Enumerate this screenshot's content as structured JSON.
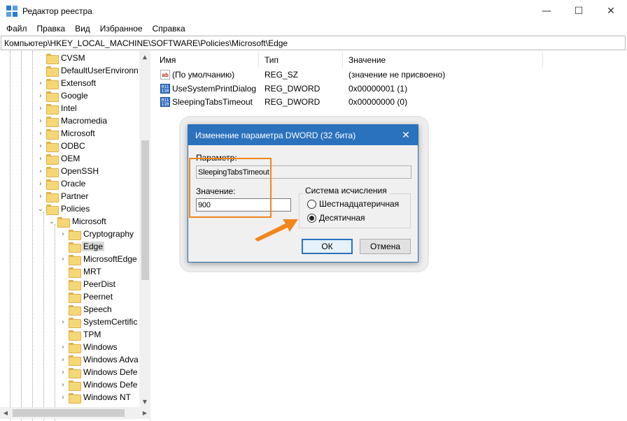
{
  "window": {
    "title": "Редактор реестра",
    "controls": {
      "minimize": "—",
      "maximize": "☐",
      "close": "✕"
    }
  },
  "menu": [
    "Файл",
    "Правка",
    "Вид",
    "Избранное",
    "Справка"
  ],
  "address": "Компьютер\\HKEY_LOCAL_MACHINE\\SOFTWARE\\Policies\\Microsoft\\Edge",
  "tree": {
    "items": [
      {
        "label": "CVSM",
        "expander": ""
      },
      {
        "label": "DefaultUserEnvironn",
        "expander": ""
      },
      {
        "label": "Extensoft",
        "expander": "›"
      },
      {
        "label": "Google",
        "expander": "›"
      },
      {
        "label": "Intel",
        "expander": "›"
      },
      {
        "label": "Macromedia",
        "expander": "›"
      },
      {
        "label": "Microsoft",
        "expander": "›"
      },
      {
        "label": "ODBC",
        "expander": "›"
      },
      {
        "label": "OEM",
        "expander": "›"
      },
      {
        "label": "OpenSSH",
        "expander": "›"
      },
      {
        "label": "Oracle",
        "expander": "›"
      },
      {
        "label": "Partner",
        "expander": "›"
      },
      {
        "label": "Policies",
        "expander": "⌄"
      },
      {
        "label": "Microsoft",
        "expander": "⌄"
      },
      {
        "label": "Cryptography",
        "expander": "›"
      },
      {
        "label": "Edge",
        "expander": ""
      },
      {
        "label": "MicrosoftEdge",
        "expander": "›"
      },
      {
        "label": "MRT",
        "expander": ""
      },
      {
        "label": "PeerDist",
        "expander": ""
      },
      {
        "label": "Peernet",
        "expander": ""
      },
      {
        "label": "Speech",
        "expander": ""
      },
      {
        "label": "SystemCertific",
        "expander": "›"
      },
      {
        "label": "TPM",
        "expander": ""
      },
      {
        "label": "Windows",
        "expander": "›"
      },
      {
        "label": "Windows Adva",
        "expander": "›"
      },
      {
        "label": "Windows Defe",
        "expander": "›"
      },
      {
        "label": "Windows Defe",
        "expander": "›"
      },
      {
        "label": "Windows NT",
        "expander": "›"
      }
    ],
    "selected": "Edge"
  },
  "list": {
    "columns": [
      "Имя",
      "Тип",
      "Значение"
    ],
    "rows": [
      {
        "icon": "string-value-icon",
        "name": "(По умолчанию)",
        "type": "REG_SZ",
        "value": "(значение не присвоено)"
      },
      {
        "icon": "dword-value-icon",
        "name": "UseSystemPrintDialog",
        "type": "REG_DWORD",
        "value": "0x00000001 (1)"
      },
      {
        "icon": "dword-value-icon",
        "name": "SleepingTabsTimeout",
        "type": "REG_DWORD",
        "value": "0x00000000 (0)"
      }
    ]
  },
  "dialog": {
    "title": "Изменение параметра DWORD (32 бита)",
    "param_label": "Параметр:",
    "param_value": "SleepingTabsTimeout",
    "value_label": "Значение:",
    "value_input": "900",
    "base_legend": "Система исчисления",
    "radio_hex": "Шестнадцатеричная",
    "radio_dec": "Десятичная",
    "selected_base": "Десятичная",
    "ok": "ОК",
    "cancel": "Отмена"
  },
  "colors": {
    "accent": "#2b72bd",
    "highlight": "#f0861c",
    "folder": "#f6d776"
  }
}
